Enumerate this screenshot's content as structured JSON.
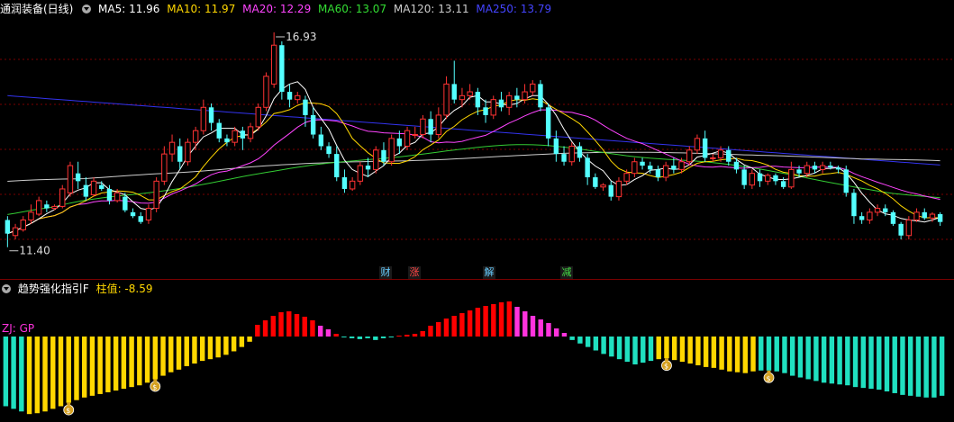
{
  "header": {
    "stock_name": "通润装备(日线)",
    "ma": [
      {
        "label": "MA5: 11.96",
        "color": "#ffffff"
      },
      {
        "label": "MA10: 11.97",
        "color": "#ffd700"
      },
      {
        "label": "MA20: 12.29",
        "color": "#ff44ff"
      },
      {
        "label": "MA60: 13.07",
        "color": "#33dd33"
      },
      {
        "label": "MA120: 13.11",
        "color": "#cccccc"
      },
      {
        "label": "MA250: 13.79",
        "color": "#4444ff"
      }
    ]
  },
  "price_chart": {
    "high_label": "16.93",
    "low_label": "11.40",
    "price_range": [
      11.0,
      17.3
    ],
    "candles": [
      [
        12.1,
        11.75,
        12.2,
        11.4
      ],
      [
        11.7,
        11.9,
        12.0,
        11.6
      ],
      [
        11.85,
        12.1,
        12.2,
        11.8
      ],
      [
        12.1,
        12.3,
        12.5,
        12.0
      ],
      [
        12.25,
        12.6,
        12.7,
        12.2
      ],
      [
        12.5,
        12.4,
        12.6,
        12.3
      ],
      [
        12.4,
        12.45,
        12.5,
        12.35
      ],
      [
        12.45,
        12.9,
        13.0,
        12.4
      ],
      [
        12.8,
        13.5,
        13.6,
        12.7
      ],
      [
        13.3,
        13.1,
        13.6,
        12.9
      ],
      [
        13.0,
        12.7,
        13.2,
        12.6
      ],
      [
        12.75,
        13.1,
        13.2,
        12.7
      ],
      [
        13.0,
        12.9,
        13.1,
        12.85
      ],
      [
        12.9,
        12.6,
        13.0,
        12.5
      ],
      [
        12.6,
        12.8,
        12.9,
        12.55
      ],
      [
        12.7,
        12.35,
        12.8,
        12.3
      ],
      [
        12.3,
        12.2,
        12.4,
        12.15
      ],
      [
        12.2,
        12.05,
        12.3,
        12.0
      ],
      [
        12.1,
        12.4,
        12.5,
        12.0
      ],
      [
        12.4,
        13.1,
        13.2,
        12.3
      ],
      [
        13.1,
        13.8,
        14.0,
        13.0
      ],
      [
        13.8,
        14.1,
        14.3,
        13.6
      ],
      [
        14.0,
        13.6,
        14.2,
        13.4
      ],
      [
        13.6,
        14.1,
        14.2,
        13.5
      ],
      [
        14.1,
        14.4,
        14.5,
        13.9
      ],
      [
        14.4,
        15.0,
        15.2,
        14.3
      ],
      [
        15.0,
        14.6,
        15.1,
        14.4
      ],
      [
        14.6,
        14.2,
        14.7,
        14.1
      ],
      [
        14.2,
        14.1,
        14.3,
        14.0
      ],
      [
        14.1,
        14.4,
        14.5,
        14.0
      ],
      [
        14.4,
        14.2,
        14.5,
        13.9
      ],
      [
        14.2,
        14.5,
        14.6,
        14.1
      ],
      [
        14.5,
        15.0,
        15.1,
        14.4
      ],
      [
        15.0,
        15.8,
        15.9,
        14.9
      ],
      [
        15.6,
        16.6,
        16.93,
        15.5
      ],
      [
        16.6,
        15.4,
        16.7,
        15.2
      ],
      [
        15.4,
        15.2,
        15.6,
        15.0
      ],
      [
        15.2,
        15.3,
        15.4,
        15.1
      ],
      [
        15.2,
        14.8,
        15.3,
        14.5
      ],
      [
        14.8,
        14.3,
        15.0,
        14.2
      ],
      [
        14.3,
        14.0,
        14.5,
        13.9
      ],
      [
        14.0,
        13.8,
        14.1,
        13.7
      ],
      [
        13.8,
        13.2,
        14.0,
        13.1
      ],
      [
        13.2,
        12.9,
        13.4,
        12.8
      ],
      [
        12.9,
        13.1,
        13.2,
        12.85
      ],
      [
        13.1,
        13.5,
        13.6,
        13.0
      ],
      [
        13.5,
        13.4,
        13.7,
        13.2
      ],
      [
        13.4,
        13.9,
        14.0,
        13.3
      ],
      [
        13.9,
        13.6,
        14.1,
        13.5
      ],
      [
        13.6,
        14.2,
        14.3,
        13.5
      ],
      [
        14.2,
        14.0,
        14.4,
        13.8
      ],
      [
        14.0,
        14.4,
        14.5,
        13.9
      ],
      [
        14.3,
        14.3,
        14.5,
        14.2
      ],
      [
        14.3,
        14.7,
        14.8,
        14.2
      ],
      [
        14.7,
        14.3,
        14.9,
        14.1
      ],
      [
        14.3,
        14.8,
        15.0,
        14.2
      ],
      [
        14.8,
        15.6,
        15.8,
        14.7
      ],
      [
        15.6,
        15.2,
        16.2,
        15.1
      ],
      [
        15.2,
        15.3,
        15.5,
        15.0
      ],
      [
        15.3,
        15.4,
        15.6,
        15.2
      ],
      [
        15.4,
        15.0,
        15.5,
        14.8
      ],
      [
        15.0,
        14.8,
        15.2,
        14.6
      ],
      [
        14.8,
        15.2,
        15.3,
        14.7
      ],
      [
        15.2,
        15.0,
        15.4,
        14.9
      ],
      [
        15.0,
        15.3,
        15.4,
        14.8
      ],
      [
        15.3,
        15.2,
        15.5,
        15.0
      ],
      [
        15.2,
        15.4,
        15.6,
        15.1
      ],
      [
        15.4,
        15.6,
        15.7,
        15.3
      ],
      [
        15.6,
        15.0,
        15.7,
        14.9
      ],
      [
        15.0,
        14.2,
        15.1,
        14.0
      ],
      [
        14.2,
        13.8,
        14.4,
        13.6
      ],
      [
        13.8,
        13.6,
        14.0,
        13.5
      ],
      [
        13.6,
        14.0,
        14.1,
        13.5
      ],
      [
        14.0,
        13.7,
        14.1,
        13.6
      ],
      [
        13.7,
        13.2,
        13.8,
        13.0
      ],
      [
        13.2,
        12.95,
        13.3,
        12.9
      ],
      [
        12.95,
        13.0,
        13.05,
        12.85
      ],
      [
        13.0,
        12.7,
        13.1,
        12.6
      ],
      [
        12.7,
        13.1,
        13.2,
        12.6
      ],
      [
        13.1,
        13.3,
        13.4,
        13.0
      ],
      [
        13.3,
        13.6,
        13.7,
        13.2
      ],
      [
        13.6,
        13.5,
        13.7,
        13.4
      ],
      [
        13.5,
        13.4,
        13.6,
        13.3
      ],
      [
        13.4,
        13.2,
        13.5,
        13.1
      ],
      [
        13.2,
        13.5,
        13.6,
        13.1
      ],
      [
        13.5,
        13.4,
        13.7,
        13.3
      ],
      [
        13.4,
        13.6,
        13.7,
        13.3
      ],
      [
        13.6,
        13.9,
        14.0,
        13.5
      ],
      [
        13.9,
        14.2,
        14.3,
        13.8
      ],
      [
        14.2,
        13.7,
        14.4,
        13.6
      ],
      [
        13.7,
        13.7,
        13.8,
        13.6
      ],
      [
        13.7,
        13.9,
        14.0,
        13.6
      ],
      [
        13.9,
        13.6,
        14.0,
        13.5
      ],
      [
        13.6,
        13.4,
        13.7,
        13.3
      ],
      [
        13.4,
        13.0,
        13.5,
        12.9
      ],
      [
        13.0,
        13.3,
        13.4,
        12.9
      ],
      [
        13.3,
        13.1,
        13.4,
        12.95
      ],
      [
        13.1,
        13.25,
        13.3,
        13.0
      ],
      [
        13.25,
        13.1,
        13.3,
        13.0
      ],
      [
        13.1,
        12.95,
        13.2,
        12.9
      ],
      [
        12.95,
        13.4,
        13.6,
        12.9
      ],
      [
        13.4,
        13.3,
        13.5,
        13.2
      ],
      [
        13.3,
        13.5,
        13.6,
        13.2
      ],
      [
        13.5,
        13.4,
        13.6,
        13.3
      ],
      [
        13.4,
        13.5,
        13.6,
        13.3
      ],
      [
        13.5,
        13.45,
        13.6,
        13.4
      ],
      [
        13.45,
        13.4,
        13.5,
        13.3
      ],
      [
        13.4,
        12.8,
        13.5,
        12.7
      ],
      [
        12.8,
        12.2,
        12.9,
        12.0
      ],
      [
        12.2,
        12.1,
        12.3,
        12.0
      ],
      [
        12.1,
        12.3,
        12.4,
        12.0
      ],
      [
        12.3,
        12.4,
        12.5,
        12.2
      ],
      [
        12.4,
        12.3,
        12.5,
        12.2
      ],
      [
        12.3,
        12.0,
        12.35,
        11.95
      ],
      [
        12.0,
        11.7,
        12.05,
        11.6
      ],
      [
        11.7,
        12.1,
        12.2,
        11.6
      ],
      [
        12.1,
        12.3,
        12.4,
        12.05
      ],
      [
        12.3,
        12.15,
        12.4,
        12.1
      ],
      [
        12.15,
        12.25,
        12.3,
        12.05
      ],
      [
        12.25,
        12.05,
        12.3,
        11.95
      ]
    ]
  },
  "news_tags": [
    {
      "label": "财",
      "color": "#66ccff"
    },
    {
      "label": "涨",
      "color": "#ff4444"
    },
    {
      "label": "解",
      "color": "#66ccff"
    },
    {
      "label": "减",
      "color": "#44dd44"
    }
  ],
  "indicator": {
    "title": "趋势强化指引F",
    "value_label": "柱值: -8.59",
    "side_label": "ZJ: GP",
    "range": [
      -9.5,
      4.5
    ],
    "bars": [
      -8.0,
      -8.3,
      -8.6,
      -8.9,
      -8.8,
      -8.6,
      -8.3,
      -8.0,
      -7.6,
      -7.3,
      -7.0,
      -6.8,
      -6.6,
      -6.4,
      -6.2,
      -6.0,
      -5.8,
      -5.6,
      -5.3,
      -4.9,
      -4.5,
      -4.1,
      -3.8,
      -3.4,
      -3.1,
      -2.8,
      -2.6,
      -2.4,
      -2.1,
      -1.7,
      -1.2,
      -0.6,
      1.3,
      1.8,
      2.3,
      2.7,
      2.8,
      2.5,
      2.2,
      1.8,
      1.2,
      0.8,
      0.3,
      -0.1,
      -0.2,
      -0.3,
      -0.2,
      -0.4,
      -0.2,
      -0.1,
      0.1,
      0.2,
      0.3,
      0.6,
      1.2,
      1.6,
      2.0,
      2.3,
      2.6,
      2.9,
      3.2,
      3.4,
      3.6,
      3.8,
      3.9,
      3.3,
      2.8,
      2.3,
      1.9,
      1.5,
      0.9,
      0.4,
      -0.4,
      -0.8,
      -1.2,
      -1.6,
      -2.0,
      -2.3,
      -2.6,
      -2.9,
      -3.2,
      -3.0,
      -2.8,
      -2.6,
      -2.5,
      -2.7,
      -2.9,
      -3.1,
      -3.3,
      -3.5,
      -3.6,
      -3.8,
      -4.0,
      -4.1,
      -4.2,
      -4.0,
      -3.9,
      -3.9,
      -4.0,
      -4.2,
      -4.5,
      -4.7,
      -4.9,
      -5.1,
      -5.3,
      -5.4,
      -5.5,
      -5.6,
      -5.8,
      -5.9,
      -6.0,
      -6.1,
      -6.3,
      -6.5,
      -6.7,
      -6.8,
      -6.9,
      -7.0,
      -7.0,
      -6.8
    ]
  },
  "colors": {
    "up": "#ff3333",
    "down": "#54ffff",
    "grid": "#7a0000",
    "indicator_red": "#ff0000",
    "indicator_magenta": "#ff33dd",
    "indicator_yellow": "#ffd700",
    "indicator_cyan": "#20e0c0",
    "money_bag": "#d4a020"
  }
}
